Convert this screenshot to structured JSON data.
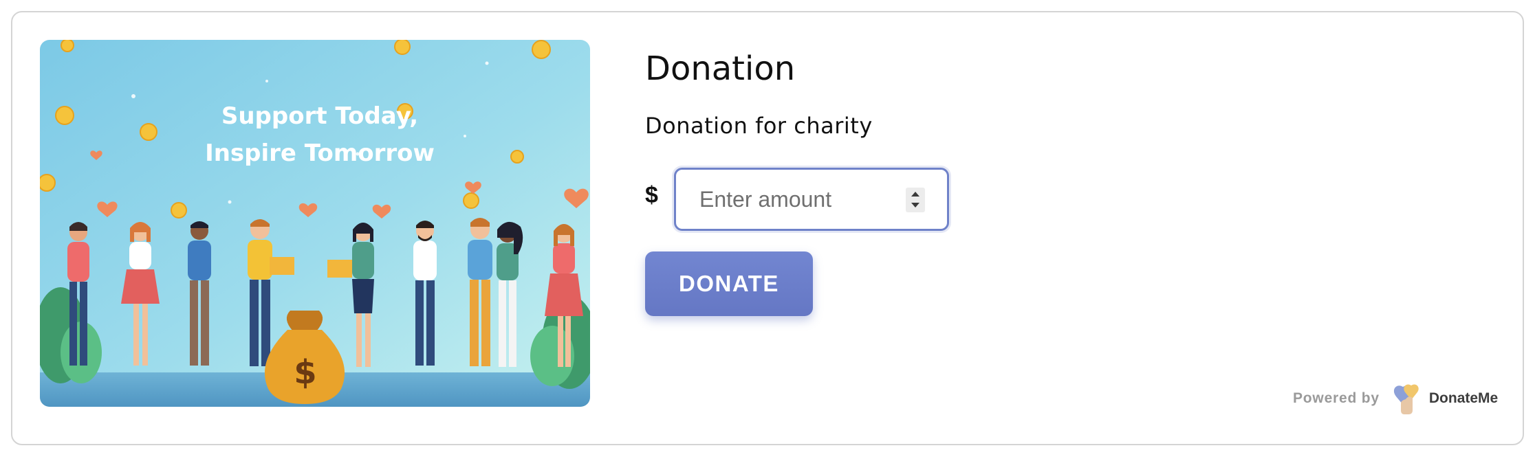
{
  "donation": {
    "title": "Donation",
    "description": "Donation for charity",
    "currency_symbol": "$",
    "amount_placeholder": "Enter amount",
    "amount_value": "",
    "donate_label": "DONATE"
  },
  "banner": {
    "line1": "Support Today,",
    "line2": "Inspire Tomorrow",
    "moneybag_symbol": "$"
  },
  "footer": {
    "powered_by": "Powered by",
    "brand_name": "DonateMe"
  },
  "colors": {
    "accent": "#6f82c9",
    "button": "#6a7cc8",
    "banner_sky": "#8fd3e8",
    "border": "#d4d4d4"
  },
  "icons": {
    "logo": "donateme-heart-hand-icon",
    "stepper": "number-stepper"
  }
}
